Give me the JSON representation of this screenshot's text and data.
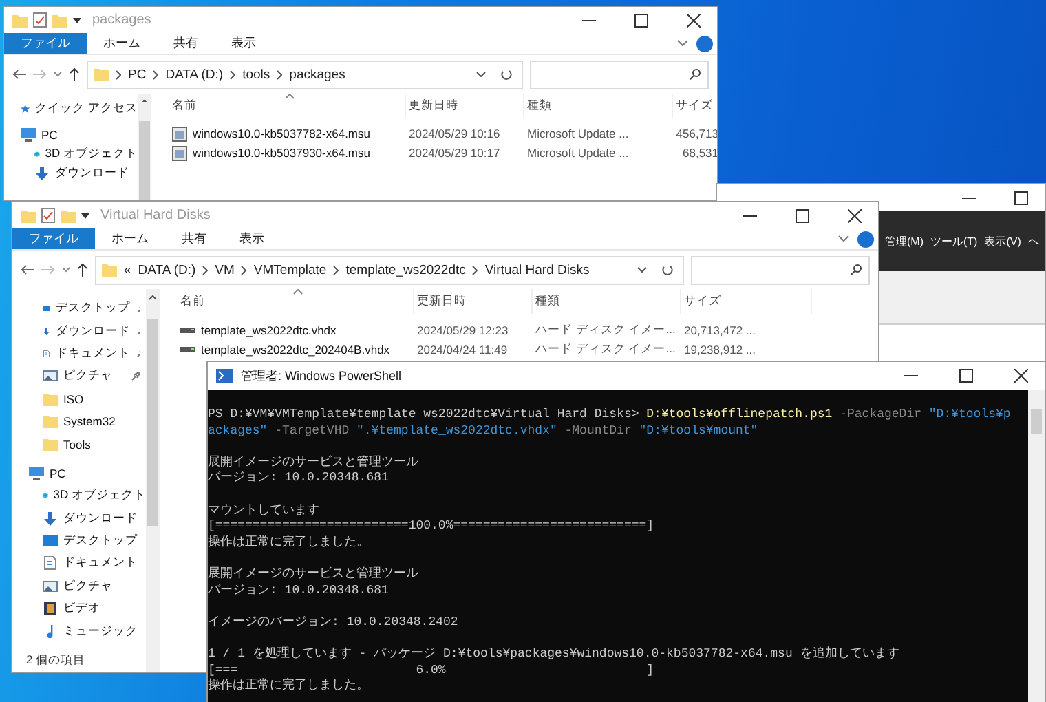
{
  "explorers": [
    {
      "title": "packages",
      "tabs": [
        {
          "label": "ファイル",
          "selected": true
        },
        {
          "label": "ホーム",
          "selected": false
        },
        {
          "label": "共有",
          "selected": false
        },
        {
          "label": "表示",
          "selected": false
        }
      ],
      "address": {
        "crumbs": [
          "PC",
          "DATA (D:)",
          "tools",
          "packages"
        ]
      },
      "sidebar": [
        {
          "label": "クイック アクセス",
          "kind": "star"
        },
        {
          "label": "PC",
          "kind": "pc",
          "children": [
            {
              "label": "3D オブジェクト",
              "kind": "cube",
              "pinned": false
            },
            {
              "label": "ダウンロード",
              "kind": "download",
              "pinned": false
            }
          ]
        }
      ],
      "columns": [
        "名前",
        "更新日時",
        "種類",
        "サイズ"
      ],
      "rows": [
        {
          "kind": "package",
          "cells": [
            "windows10.0-kb5037782-x64.msu",
            "2024/05/29 10:16",
            "Microsoft Update ...",
            "456,713"
          ]
        },
        {
          "kind": "package",
          "cells": [
            "windows10.0-kb5037930-x64.msu",
            "2024/05/29 10:17",
            "Microsoft Update ...",
            "68,531"
          ]
        }
      ]
    },
    {
      "title": "Virtual Hard Disks",
      "tabs": [
        {
          "label": "ファイル",
          "selected": true
        },
        {
          "label": "ホーム",
          "selected": false
        },
        {
          "label": "共有",
          "selected": false
        },
        {
          "label": "表示",
          "selected": false
        }
      ],
      "address": {
        "overflow_mark": "«",
        "crumbs": [
          "DATA (D:)",
          "VM",
          "VMTemplate",
          "template_ws2022dtc",
          "Virtual Hard Disks"
        ]
      },
      "sidebar": [
        {
          "children": [
            {
              "label": "デスクトップ",
              "kind": "desktop",
              "pinned": true
            },
            {
              "label": "ダウンロード",
              "kind": "download",
              "pinned": true
            },
            {
              "label": "ドキュメント",
              "kind": "document",
              "pinned": true
            },
            {
              "label": "ピクチャ",
              "kind": "picture",
              "pinned": true
            },
            {
              "label": "ISO",
              "kind": "folder",
              "pinned": false
            },
            {
              "label": "System32",
              "kind": "folder",
              "pinned": false
            },
            {
              "label": "Tools",
              "kind": "folder",
              "pinned": false
            }
          ]
        },
        {
          "label": "PC",
          "kind": "pc",
          "children": [
            {
              "label": "3D オブジェクト",
              "kind": "cube",
              "pinned": false
            },
            {
              "label": "ダウンロード",
              "kind": "download",
              "pinned": false
            },
            {
              "label": "デスクトップ",
              "kind": "desktop",
              "pinned": false
            },
            {
              "label": "ドキュメント",
              "kind": "document",
              "pinned": false
            },
            {
              "label": "ピクチャ",
              "kind": "picture",
              "pinned": false
            },
            {
              "label": "ビデオ",
              "kind": "video",
              "pinned": false
            },
            {
              "label": "ミュージック",
              "kind": "music",
              "pinned": false
            }
          ]
        }
      ],
      "columns": [
        "名前",
        "更新日時",
        "種類",
        "サイズ"
      ],
      "rows": [
        {
          "kind": "disk",
          "cells": [
            "template_ws2022dtc.vhdx",
            "2024/05/29 12:23",
            "ハード ディスク イメー...",
            "20,713,472 ..."
          ]
        },
        {
          "kind": "disk",
          "cells": [
            "template_ws2022dtc_202404B.vhdx",
            "2024/04/24 11:49",
            "ハード ディスク イメー...",
            "19,238,912 ..."
          ]
        }
      ],
      "status": "2 個の項目"
    }
  ],
  "background_window": {
    "menu": [
      "管理(M)",
      "ツール(T)",
      "表示(V)",
      "ヘ"
    ]
  },
  "powershell": {
    "title": "管理者: Windows PowerShell",
    "blocks": [
      [
        [
          {
            "kind": "plain",
            "text": "PS D:¥VM¥VMTemplate¥template_ws2022dtc¥Virtual Hard Disks> "
          },
          {
            "kind": "command",
            "text": "D:¥tools¥offlinepatch.ps1"
          },
          {
            "kind": "param",
            "text": " -PackageDir "
          },
          {
            "kind": "string",
            "text": "\"D:¥tools¥p"
          }
        ],
        [
          {
            "kind": "string",
            "text": "ackages\""
          },
          {
            "kind": "param",
            "text": " -TargetVHD "
          },
          {
            "kind": "string",
            "text": "\".¥template_ws2022dtc.vhdx\""
          },
          {
            "kind": "param",
            "text": " -MountDir "
          },
          {
            "kind": "string",
            "text": "\"D:¥tools¥mount\""
          }
        ]
      ],
      [
        [
          {
            "kind": "plain",
            "text": "展開イメージのサービスと管理ツール"
          }
        ],
        [
          {
            "kind": "plain",
            "text": "バージョン: 10.0.20348.681"
          }
        ]
      ],
      [
        [
          {
            "kind": "plain",
            "text": "マウントしています"
          }
        ],
        [
          {
            "kind": "plain",
            "text": "[==========================100.0%==========================]"
          }
        ],
        [
          {
            "kind": "plain",
            "text": "操作は正常に完了しました。"
          }
        ]
      ],
      [
        [
          {
            "kind": "plain",
            "text": "展開イメージのサービスと管理ツール"
          }
        ],
        [
          {
            "kind": "plain",
            "text": "バージョン: 10.0.20348.681"
          }
        ]
      ],
      [
        [
          {
            "kind": "plain",
            "text": "イメージのバージョン: 10.0.20348.2402"
          }
        ]
      ],
      [
        [
          {
            "kind": "plain",
            "text": "1 / 1 を処理しています - パッケージ D:¥tools¥packages¥windows10.0-kb5037782-x64.msu を追加しています"
          }
        ],
        [
          {
            "kind": "plain",
            "text": "[===                        6.0%                           ]"
          }
        ],
        [
          {
            "kind": "plain",
            "text": "操作は正常に完了しました。"
          }
        ]
      ]
    ]
  }
}
